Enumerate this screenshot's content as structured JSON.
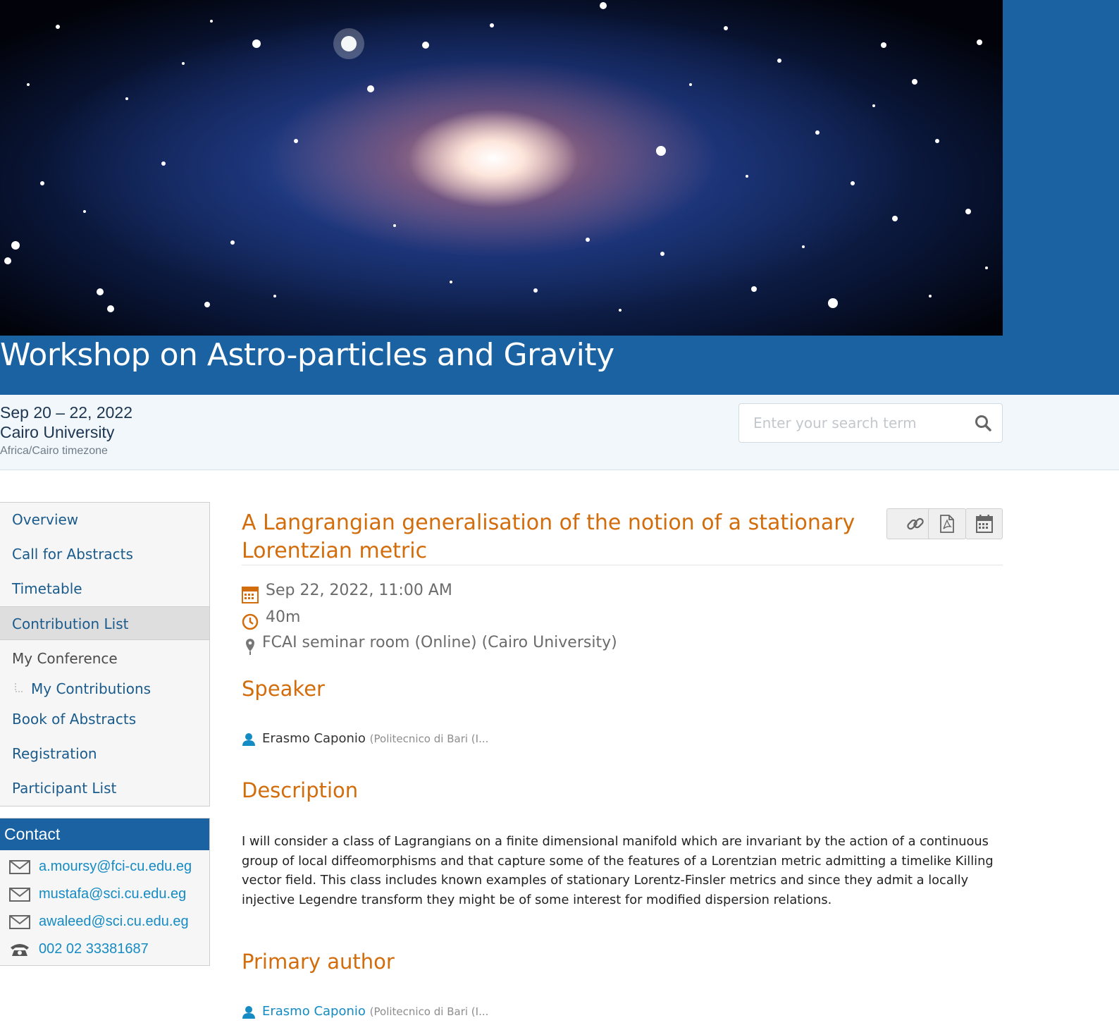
{
  "event": {
    "title": "Workshop on Astro-particles and Gravity",
    "dates": "Sep 20 – 22, 2022",
    "venue": "Cairo University",
    "timezone": "Africa/Cairo timezone"
  },
  "search": {
    "placeholder": "Enter your search term"
  },
  "menu": {
    "items": [
      {
        "label": "Overview"
      },
      {
        "label": "Call for Abstracts"
      },
      {
        "label": "Timetable"
      },
      {
        "label": "Contribution List",
        "active": true
      },
      {
        "label": "My Conference"
      },
      {
        "label": "My Contributions"
      },
      {
        "label": "Book of Abstracts"
      },
      {
        "label": "Registration"
      },
      {
        "label": "Participant List"
      }
    ]
  },
  "contact": {
    "heading": "Contact",
    "emails": [
      "a.moursy@fci-cu.edu.eg",
      "mustafa@sci.cu.edu.eg",
      "awaleed@sci.cu.edu.eg"
    ],
    "phone": "002 02 33381687"
  },
  "contribution": {
    "title_line1": "A Langrangian generalisation of the notion of a stationary",
    "title_line2": "Lorentzian metric",
    "datetime": "Sep 22, 2022, 11:00 AM",
    "duration": "40m",
    "location": "FCAI seminar room (Online) (Cairo University)",
    "speaker_heading": "Speaker",
    "speaker_name": "Erasmo Caponio",
    "speaker_affiliation": "(Politecnico di Bari (I...",
    "description_heading": "Description",
    "description": "I will consider a class of Lagrangians on a finite dimensional manifold which are invariant by the action of a continuous group of local diffeomorphisms and that capture some of the features of a Lorentzian metric admitting a timelike Killing vector field. This class includes known examples of stationary Lorentz-Finsler metrics and since they admit a locally injective Legendre transform they might be of some interest for modified dispersion relations.",
    "primary_author_heading": "Primary author",
    "primary_author_name": "Erasmo Caponio",
    "primary_author_affiliation": "(Politecnico di Bari (I..."
  },
  "colors": {
    "brand_blue": "#1a62a1",
    "accent_orange": "#d36c0b",
    "link_blue": "#158bc4",
    "menu_text": "#1a5b8c"
  },
  "icons": {
    "search": "search-icon",
    "permalink": "link-icon",
    "pdf": "pdf-icon",
    "calendar_export": "calendar-icon",
    "date": "calendar-icon",
    "duration": "clock-icon",
    "location": "map-pin-icon",
    "person": "user-icon",
    "email": "envelope-icon",
    "phone": "phone-icon"
  }
}
